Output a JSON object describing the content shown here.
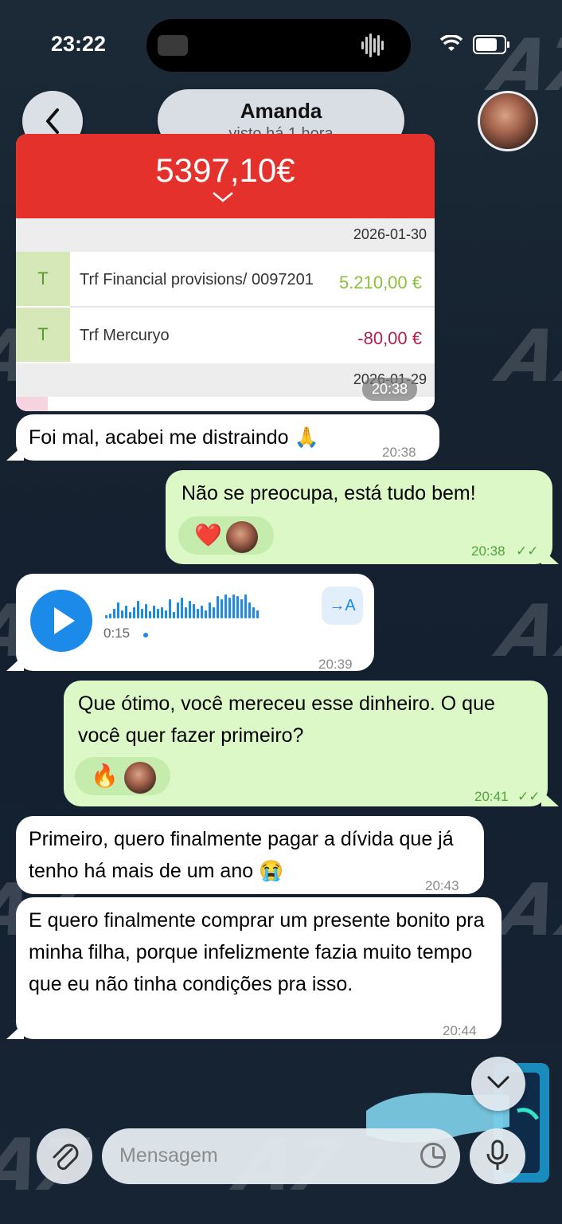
{
  "status_bar": {
    "time": "23:22"
  },
  "header": {
    "contact_name": "Amanda",
    "last_seen": "visto há 1 hora"
  },
  "image_message": {
    "balance": "5397,10€",
    "date_1": "2026-01-30",
    "transactions": [
      {
        "type": "T",
        "description": "Trf Financial provisions/ 0097201",
        "amount": "5.210,00 €",
        "color": "#8cbf3f"
      },
      {
        "type": "T",
        "description": "Trf Mercuryo",
        "amount": "-80,00 €",
        "color": "#b3204d"
      }
    ],
    "date_2": "2026-01-29",
    "time": "20:38"
  },
  "messages": [
    {
      "direction": "in",
      "text": "Foi mal, acabei me distraindo 🙏",
      "time": "20:38"
    },
    {
      "direction": "out",
      "text": "Não se preocupa, está tudo bem!",
      "time": "20:38",
      "status": "✓✓",
      "reaction": "❤️"
    },
    {
      "direction": "in",
      "type": "voice",
      "duration": "0:15",
      "transcribe_label": "→A",
      "time": "20:39"
    },
    {
      "direction": "out",
      "text": "Que ótimo, você mereceu esse dinheiro. O que você quer fazer primeiro?",
      "time": "20:41",
      "status": "✓✓",
      "reaction": "🔥"
    },
    {
      "direction": "in",
      "text": "Primeiro, quero finalmente pagar a dívida que já tenho há mais de um ano 😭",
      "time": "20:43"
    },
    {
      "direction": "in",
      "text": "E quero finalmente comprar um presente bonito pra minha filha, porque infelizmente fazia muito tempo que eu não tinha condições pra isso.",
      "time": "20:44"
    }
  ],
  "input": {
    "placeholder": "Mensagem"
  },
  "colors": {
    "outgoing_bubble": "#dcf8c6",
    "incoming_bubble": "#ffffff",
    "accent": "#1c8ae8"
  }
}
